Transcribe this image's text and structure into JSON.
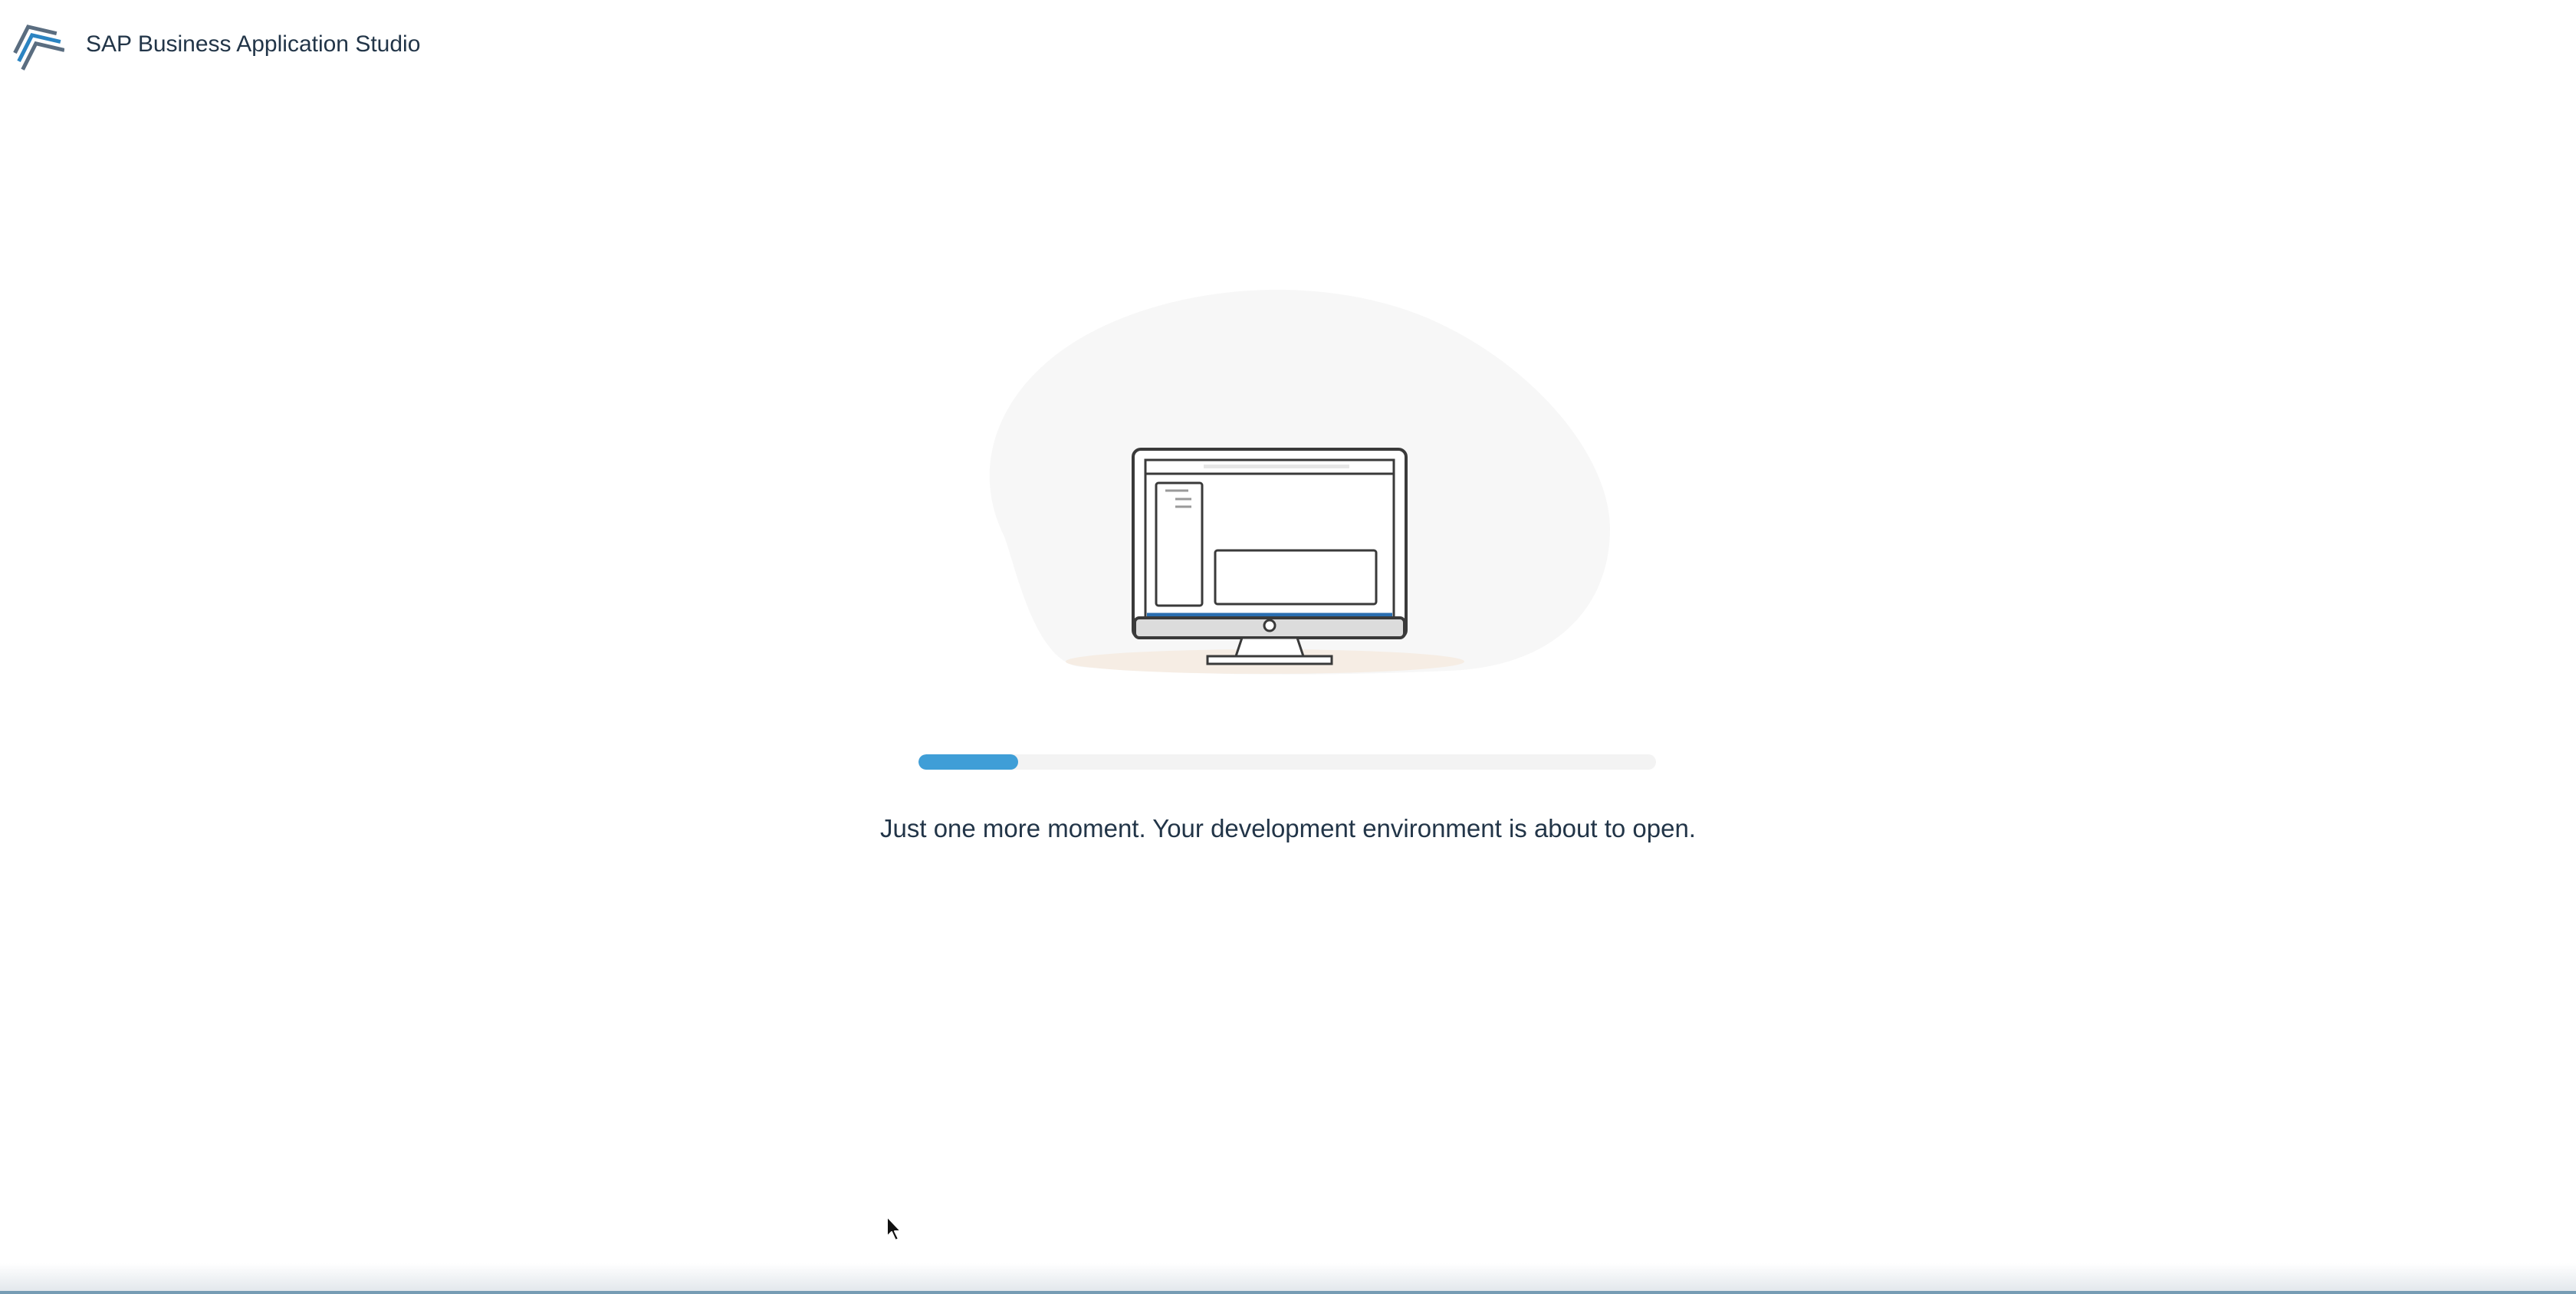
{
  "header": {
    "app_title": "SAP Business Application Studio",
    "logo_icon": "sap-bas-logo-icon"
  },
  "illustration": {
    "icon": "desktop-monitor-icon"
  },
  "progress": {
    "value_percent": 13.5,
    "fill_color": "#3f9ed7",
    "track_color": "#f3f3f3"
  },
  "status": {
    "message": "Just one more moment. Your development environment is about to open."
  },
  "colors": {
    "text": "#223548",
    "background": "#ffffff",
    "accent": "#3f9ed7"
  }
}
